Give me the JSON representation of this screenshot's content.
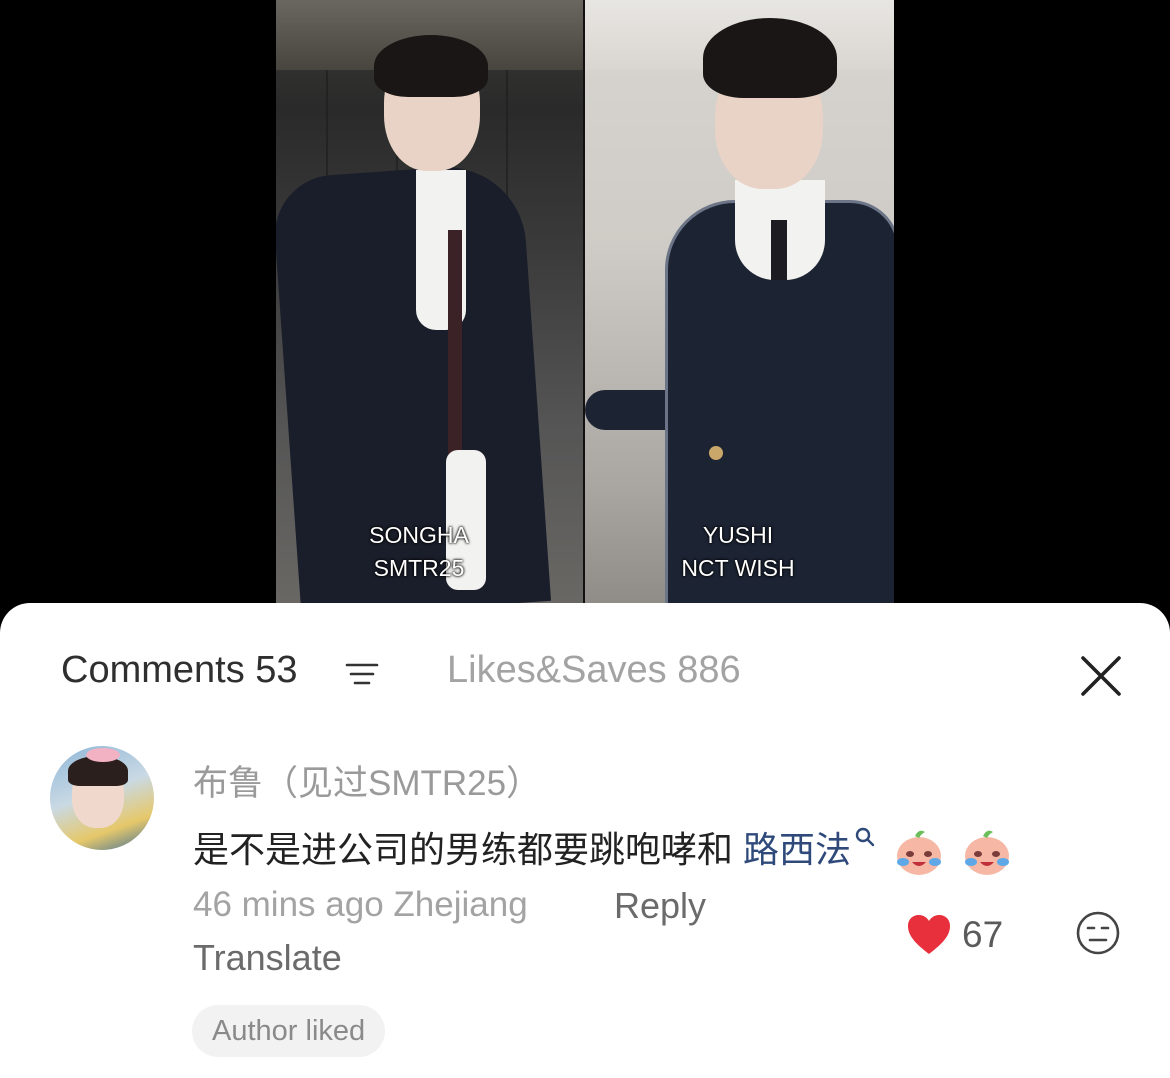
{
  "video": {
    "left_caption": {
      "name": "SONGHA",
      "group": "SMTR25"
    },
    "right_caption": {
      "name": "YUSHI",
      "group": "NCT WISH"
    }
  },
  "header": {
    "comments_tab": "Comments 53",
    "likes_saves_tab": "Likes&Saves 886",
    "close_icon": "close-icon",
    "sort_icon": "sort-icon"
  },
  "comment": {
    "username": "布鲁（见过SMTR25）",
    "text": "是不是进公司的男练都要跳咆哮和",
    "link": "路西法",
    "emoji": [
      "crying-peach-emoji",
      "crying-peach-emoji"
    ],
    "time_location": "46 mins ago Zhejiang",
    "reply_label": "Reply",
    "translate_label": "Translate",
    "like_count": "67",
    "badge": "Author liked",
    "colors": {
      "like": "#e8303c",
      "link": "#2f4a7a"
    }
  }
}
